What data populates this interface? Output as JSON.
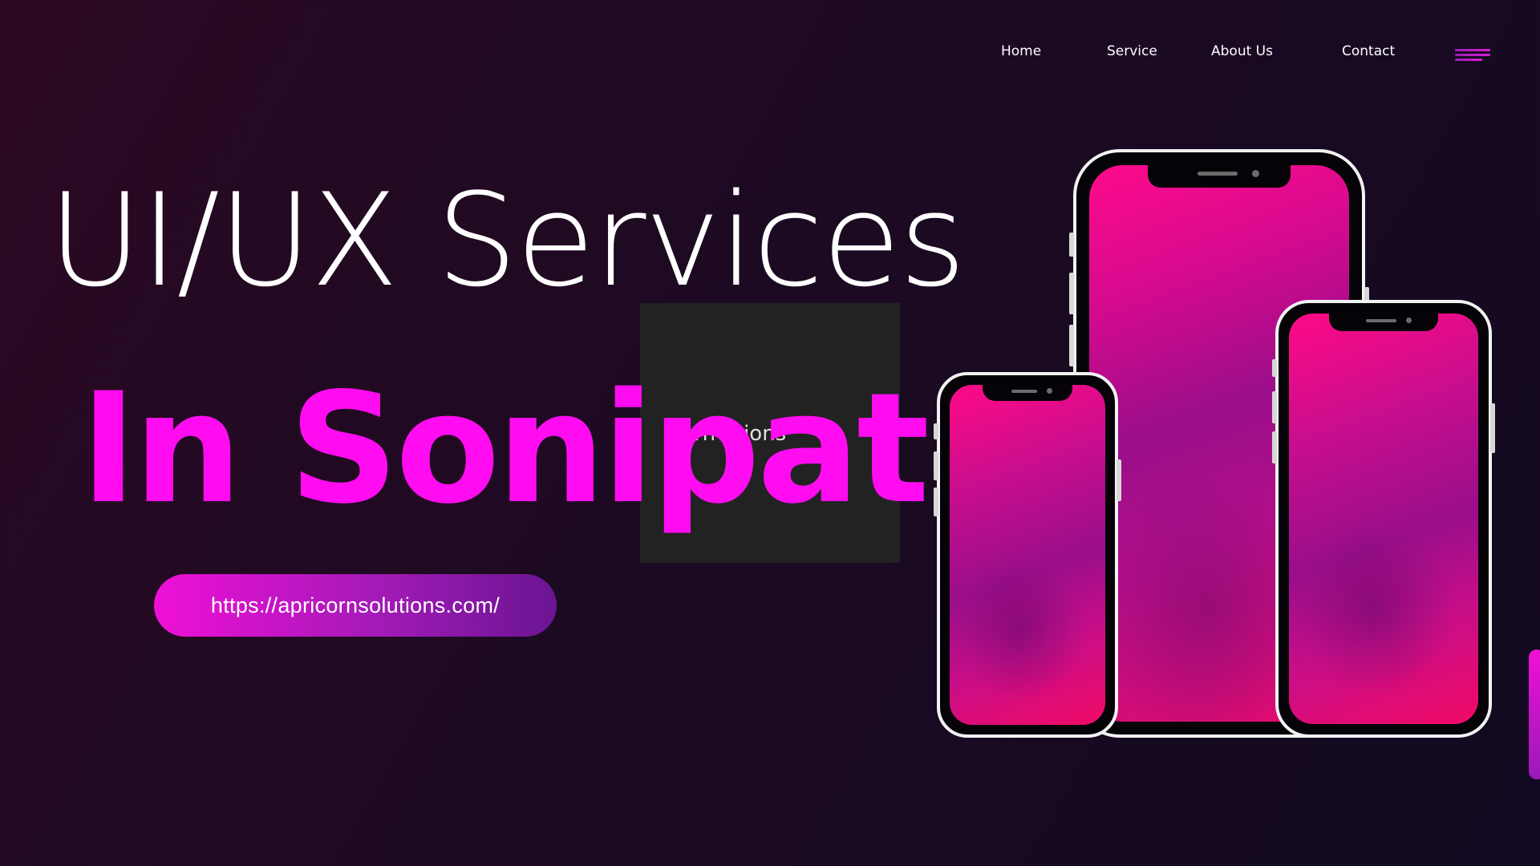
{
  "nav": {
    "items": [
      {
        "label": "Home"
      },
      {
        "label": "Service"
      },
      {
        "label": "About Us"
      },
      {
        "label": "Contact"
      }
    ],
    "menu_icon": "hamburger-menu-icon"
  },
  "hero": {
    "title_line1": "UI/UX Services",
    "title_line2": "In Sonipat",
    "overlay_text": "icorn   utions",
    "url": "https://apricornsolutions.com/"
  },
  "colors": {
    "accent": "#ff0cf0",
    "pill_start": "#ef10d6",
    "pill_end": "#6a1592",
    "background": "#1c0a22"
  },
  "images": {
    "phones": [
      "phone-mockup-large",
      "phone-mockup-small",
      "phone-mockup-right"
    ]
  }
}
